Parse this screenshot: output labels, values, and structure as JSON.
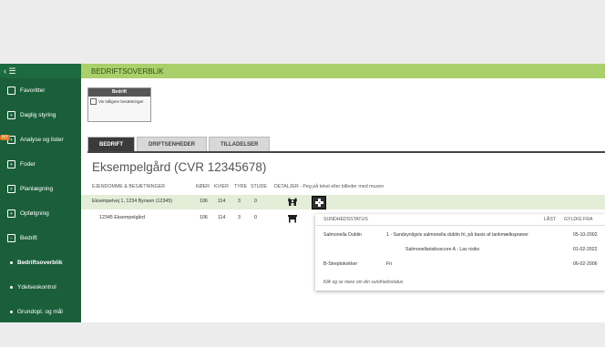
{
  "sidebar": {
    "toggle_icon": "chevron-left-menu-icon",
    "items": [
      {
        "label": "Favoritter",
        "icon": "square-icon"
      },
      {
        "label": "Daglig styring",
        "icon": "plus-square-icon"
      },
      {
        "label": "Analyse og lister",
        "icon": "plus-square-icon",
        "badge": "NY"
      },
      {
        "label": "Foder",
        "icon": "plus-square-icon"
      },
      {
        "label": "Planlægning",
        "icon": "plus-square-icon"
      },
      {
        "label": "Opfølgning",
        "icon": "plus-square-icon"
      },
      {
        "label": "Bedrift",
        "icon": "minus-square-icon"
      }
    ],
    "subitems": [
      {
        "label": "Bedriftsoverblik",
        "active": true
      },
      {
        "label": "Ydelseskontrol",
        "active": false
      },
      {
        "label": "Grundopl. og mål",
        "active": false
      }
    ]
  },
  "header": {
    "title": "BEDRIFTSOVERBLIK"
  },
  "bedrift_box": {
    "title": "Bedrift",
    "checkbox_label": "Vis tidligere besætninger"
  },
  "tabs": [
    {
      "label": "BEDRIFT",
      "active": true
    },
    {
      "label": "DRIFTSENHEDER",
      "active": false
    },
    {
      "label": "TILLADELSER",
      "active": false
    }
  ],
  "title": "Eksempelgård (CVR 12345678)",
  "table": {
    "headers": {
      "property": "EJENDOMME & BESÆTNINGER",
      "koer": "KØER",
      "kvier": "KVIER",
      "tyre": "TYRE",
      "stude": "STUDE",
      "details": "DETALJER - Peg på tekst eller billeder med musen"
    },
    "rows": [
      {
        "name": "Eksempelvej 1, 1234 Bynavn (12345)",
        "koer": "106",
        "kvier": "114",
        "tyre": "3",
        "stude": "0"
      },
      {
        "name": "12345 Eksempelgård",
        "koer": "106",
        "kvier": "114",
        "tyre": "3",
        "stude": "0"
      }
    ]
  },
  "popup": {
    "headers": {
      "status": "SUNDHEDSSTATUS",
      "laast": "LÅST",
      "gyldig": "GYLDIG FRA"
    },
    "rows": [
      {
        "name": "Salmonella Dublin",
        "value": "1 - Sandsynligvis salmonella dublin fri, på basis af tankmælksprøver",
        "date": "05-10-2002"
      },
      {
        "name": "",
        "value": "Salmonellarisikoscore A - Lav risiko",
        "date": "01-02-2022"
      },
      {
        "name": "B-Streptokokker",
        "value": "Fri",
        "date": "06-02-2006"
      }
    ],
    "footer": "Klik og se mere om din sundhedsstatus"
  }
}
